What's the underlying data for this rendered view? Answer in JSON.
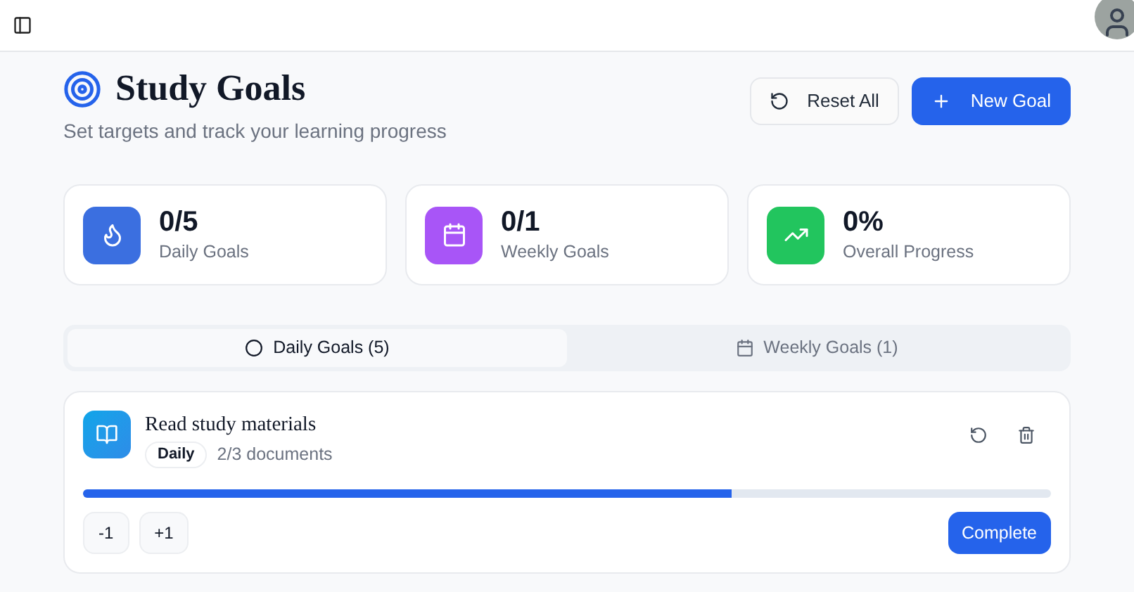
{
  "header": {
    "title": "Study Goals",
    "subtitle": "Set targets and track your learning progress"
  },
  "actions": [
    {
      "kind": "reset",
      "label": "Reset All"
    },
    {
      "kind": "new",
      "label": "New Goal"
    }
  ],
  "stats": [
    {
      "kind": "flame",
      "value": "0/5",
      "label": "Daily Goals",
      "color": "#3b6fe0"
    },
    {
      "kind": "calendar",
      "value": "0/1",
      "label": "Weekly Goals",
      "color": "#a855f7"
    },
    {
      "kind": "trend",
      "value": "0%",
      "label": "Overall Progress",
      "color": "#22c55e"
    }
  ],
  "tabs": [
    {
      "kind": "circle",
      "label": "Daily Goals (5)",
      "selected": true
    },
    {
      "kind": "calendar",
      "label": "Weekly Goals (1)",
      "selected": false
    }
  ],
  "goals": [
    {
      "title": "Read study materials",
      "badge": "Daily",
      "progress": "2/3 documents",
      "level": 0.67,
      "controls": [
        "-1",
        "+1"
      ],
      "complete": "Complete"
    }
  ]
}
